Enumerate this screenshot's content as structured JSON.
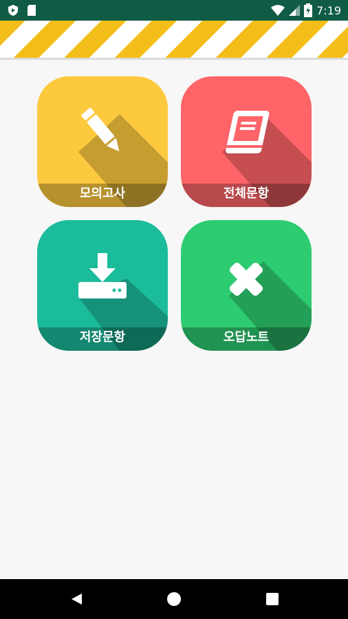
{
  "status_bar": {
    "time": "7:19"
  },
  "menu": {
    "tiles": [
      {
        "label": "모의고사",
        "color": "#fdca3f",
        "icon": "pencil-icon"
      },
      {
        "label": "전체문항",
        "color": "#fe6468",
        "icon": "book-icon"
      },
      {
        "label": "저장문항",
        "color": "#1bbc9b",
        "icon": "download-icon"
      },
      {
        "label": "오답노트",
        "color": "#2ecc71",
        "icon": "close-x-icon"
      }
    ]
  },
  "colors": {
    "status_bar": "#0f5b46",
    "stripe_yellow": "#f4be1a",
    "background": "#f7f7f7"
  }
}
